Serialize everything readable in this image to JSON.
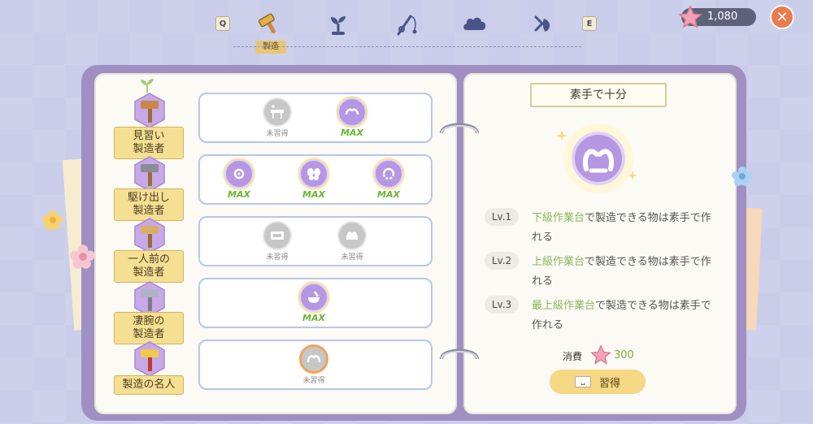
{
  "nav": {
    "key_prev": "Q",
    "key_next": "E",
    "active_label": "製造",
    "tabs": [
      {
        "icon": "hammer-icon"
      },
      {
        "icon": "sprout-icon"
      },
      {
        "icon": "fishing-rod-icon"
      },
      {
        "icon": "cloud-icon"
      },
      {
        "icon": "fish-icon"
      }
    ]
  },
  "currency": {
    "value": "1,080",
    "icon": "star-icon"
  },
  "ranks": [
    {
      "label": "見習い\n製造者"
    },
    {
      "label": "駆け出し\n製造者"
    },
    {
      "label": "一人前の\n製造者"
    },
    {
      "label": "凄腕の\n製造者"
    },
    {
      "label": "製造の名人"
    }
  ],
  "skill_rows": [
    [
      {
        "status": "未習得",
        "state": "locked"
      },
      {
        "status": "MAX",
        "state": "learned"
      }
    ],
    [
      {
        "status": "MAX",
        "state": "learned"
      },
      {
        "status": "MAX",
        "state": "learned"
      },
      {
        "status": "MAX",
        "state": "learned"
      }
    ],
    [
      {
        "status": "未習得",
        "state": "locked"
      },
      {
        "status": "未習得",
        "state": "locked"
      }
    ],
    [
      {
        "status": "MAX",
        "state": "learned"
      }
    ],
    [
      {
        "status": "未習得",
        "state": "selected"
      }
    ]
  ],
  "detail": {
    "title": "素手で十分",
    "levels": [
      {
        "badge": "Lv.1",
        "highlight": "下級作業台",
        "text": "で製造できる物は素手で作れる"
      },
      {
        "badge": "Lv.2",
        "highlight": "上級作業台",
        "text": "で製造できる物は素手で作れる"
      },
      {
        "badge": "Lv.3",
        "highlight": "最上級作業台",
        "text": "で製造できる物は素手で作れる"
      }
    ],
    "cost_label": "消費",
    "cost_value": "300",
    "learn_key": "␣",
    "learn_label": "習得"
  },
  "colors": {
    "accent_purple": "#b697e3",
    "max_green": "#6ab634",
    "highlight_green": "#8ab75a",
    "close_orange": "#ea7b4a"
  }
}
